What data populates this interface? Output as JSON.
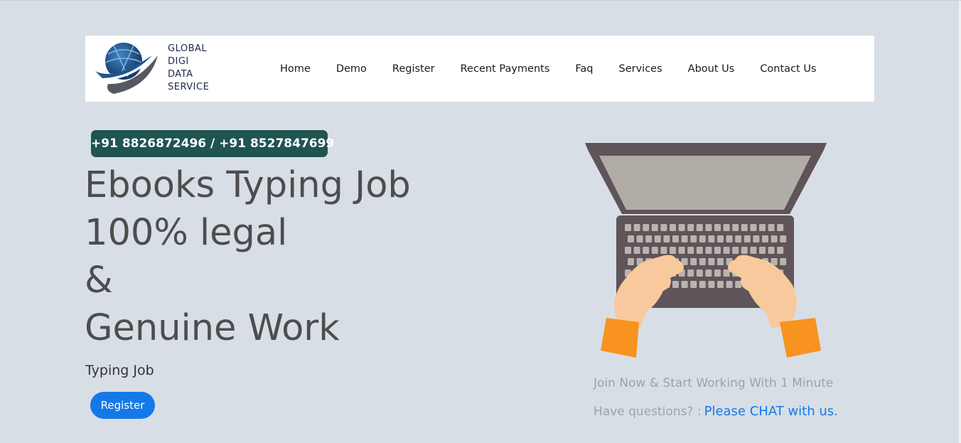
{
  "brand": {
    "logo_icon": "globe-swoosh-logo",
    "lines": [
      "GLOBAL",
      "DIGI",
      "DATA",
      "SERVICE"
    ]
  },
  "nav": {
    "items": [
      "Home",
      "Demo",
      "Register",
      "Recent Payments",
      "Faq",
      "Services",
      "About Us",
      "Contact Us"
    ]
  },
  "hero": {
    "phone": "+91 8826872496 / +91 8527847699",
    "headline": [
      "Ebooks Typing Job",
      "100% legal",
      "&",
      "Genuine Work"
    ],
    "subtitle": "Typing Job",
    "register_label": "Register",
    "illustration_icon": "laptop-typing-illustration",
    "join_text": "Join Now & Start Working With 1 Minute",
    "questions_text": "Have questions? :",
    "chat_link": "Please CHAT with us."
  },
  "colors": {
    "page_bg": "#d8dee6",
    "phone_badge": "#1f5450",
    "button": "#1479e8",
    "headline": "#4d4d4d"
  }
}
